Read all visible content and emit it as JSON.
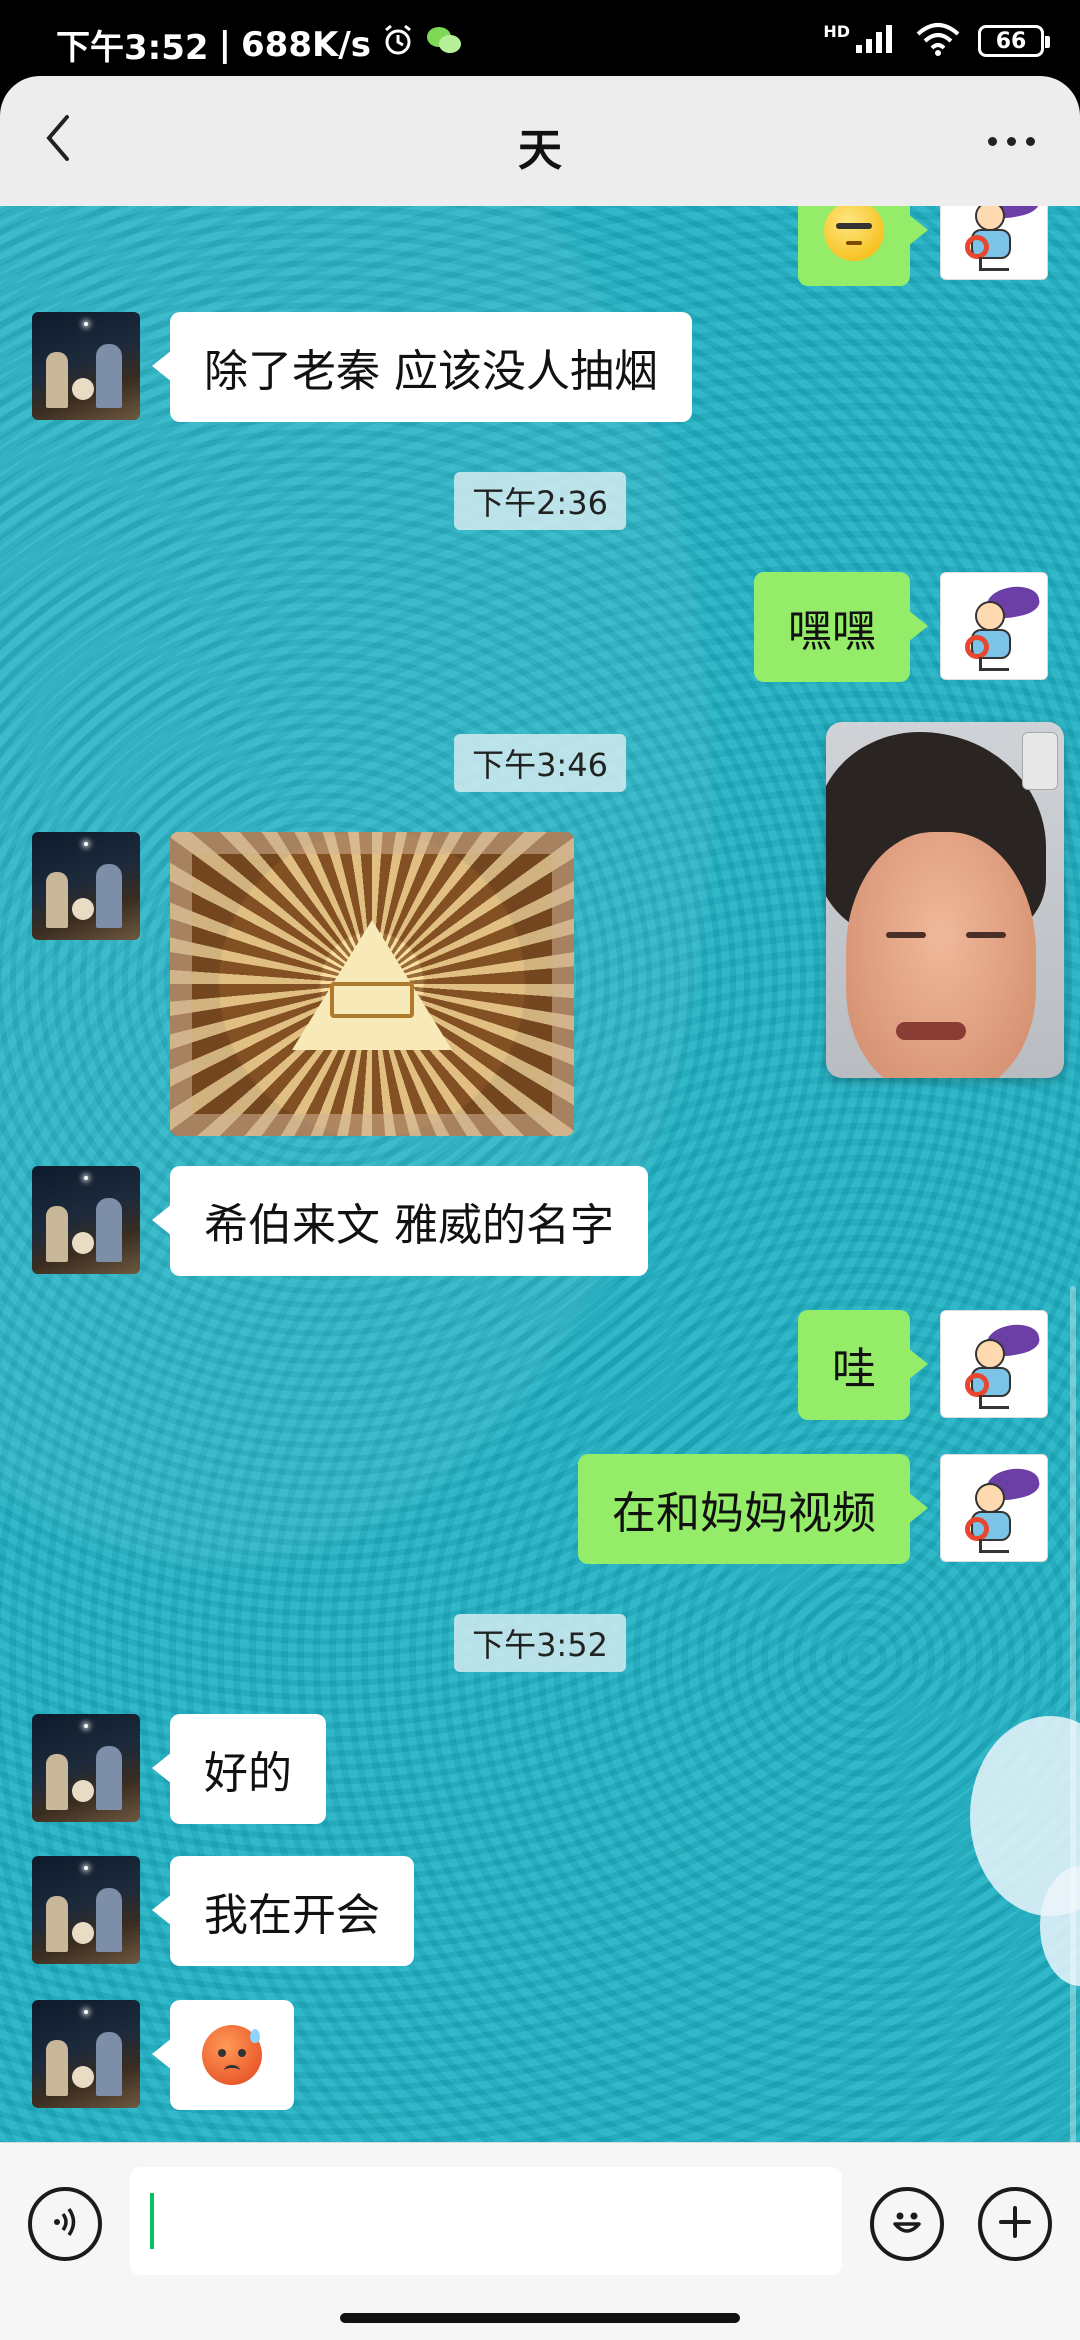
{
  "status_bar": {
    "time": "下午3:52",
    "separator": "|",
    "speed": "688K/s",
    "hd_label": "HD",
    "battery": "66"
  },
  "header": {
    "title": "天"
  },
  "messages": {
    "m2_text": "除了老秦 应该没人抽烟",
    "t1": "下午2:36",
    "m3_text": "嘿嘿",
    "t2": "下午3:46",
    "m5_text": "希伯来文 雅威的名字",
    "m6_text": "哇",
    "m7_text": "在和妈妈视频",
    "t3": "下午3:52",
    "m8_text": "好的",
    "m9_text": "我在开会"
  },
  "icons": {
    "back": "chevron-left-icon",
    "more": "more-dots-icon",
    "voice": "voice-icon",
    "emoji": "emoji-icon",
    "plus": "plus-icon",
    "alarm": "alarm-icon",
    "wechat": "wechat-icon",
    "signal": "signal-icon",
    "wifi": "wifi-icon"
  },
  "colors": {
    "bubble_me": "#95ec69",
    "bubble_them": "#ffffff",
    "chat_bg": "#1fb1c4",
    "cursor": "#07c160"
  }
}
